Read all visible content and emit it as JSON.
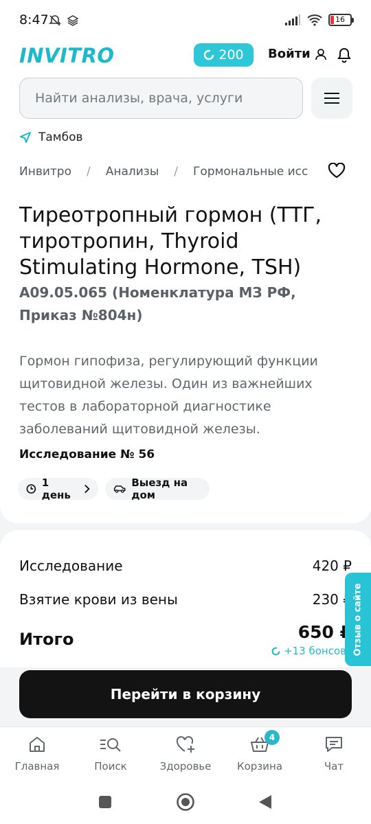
{
  "status": {
    "time": "8:47",
    "battery": "16"
  },
  "header": {
    "logo": "INVITRO",
    "bonus": "200",
    "login": "Войти"
  },
  "search": {
    "placeholder": "Найти анализы, врача, услуги"
  },
  "city": "Тамбов",
  "breadcrumbs": [
    "Инвитро",
    "Анализы",
    "Гормональные исс"
  ],
  "breadcrumb_separator": "/",
  "product": {
    "title": "Тиреотропный гормон (ТТГ, тиротропин, Thyroid Stimulating Hormone, TSH)",
    "code": "A09.05.065 (Номенклатура МЗ РФ, Приказ №804н)",
    "description": "Гормон гипофиза, регулирующий функции щитовидной железы. Один из важнейших тестов в лабораторной диагностике заболеваний щитовидной железы.",
    "study_number": "Исследование № 56",
    "chips": {
      "days": "1 день",
      "home": "Выезд на дом"
    }
  },
  "prices": {
    "rows": [
      {
        "label": "Исследование",
        "value": "420 ₽"
      },
      {
        "label": "Взятие крови из вены",
        "value": "230 ₽"
      }
    ],
    "total_label": "Итого",
    "total_value": "650 ₽",
    "bonus_add": "+13 бонсов"
  },
  "feedback": "Отзыв о сайте",
  "cta": "Перейти в корзину",
  "tabs": [
    {
      "label": "Главная",
      "icon": "home-icon"
    },
    {
      "label": "Поиск",
      "icon": "search-list-icon"
    },
    {
      "label": "Здоровье",
      "icon": "heart-plus-icon"
    },
    {
      "label": "Корзина",
      "icon": "basket-icon",
      "badge": "4"
    },
    {
      "label": "Чат",
      "icon": "chat-icon"
    }
  ],
  "colors": {
    "brand": "#1cb8cc",
    "accent": "#2ec7d8",
    "cta": "#131313"
  }
}
